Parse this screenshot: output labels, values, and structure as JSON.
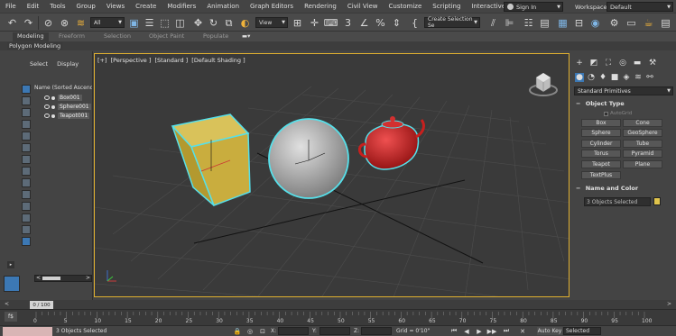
{
  "menus": [
    "File",
    "Edit",
    "Tools",
    "Group",
    "Views",
    "Create",
    "Modifiers",
    "Animation",
    "Graph Editors",
    "Rendering",
    "Civil View",
    "Customize",
    "Scripting",
    "Interactive"
  ],
  "signin_label": "Sign In",
  "workspaces_label": "Workspaces:",
  "workspace_value": "Default",
  "toolbar": {
    "filter_value": "All",
    "coord_system": "View",
    "selection_set_placeholder": "Create Selection Se"
  },
  "ribbon_tabs": [
    "Modeling",
    "Freeform",
    "Selection",
    "Object Paint",
    "Populate"
  ],
  "ribbon_active": "Modeling",
  "ribbon_sub_label": "Polygon Modeling",
  "scene_explorer": {
    "tabs": [
      "Select",
      "Display"
    ],
    "header": "Name (Sorted Ascending)",
    "items": [
      "Box001",
      "Sphere001",
      "Teapot001"
    ]
  },
  "viewport_label": [
    "[+]",
    "[Perspective ]",
    "[Standard ]",
    "[Default Shading ]"
  ],
  "command_panel": {
    "category": "Standard Primitives",
    "object_type_title": "Object Type",
    "autogrid_label": "AutoGrid",
    "object_buttons": [
      "Box",
      "Cone",
      "Sphere",
      "GeoSphere",
      "Cylinder",
      "Tube",
      "Torus",
      "Pyramid",
      "Teapot",
      "Plane",
      "TextPlus"
    ],
    "name_color_title": "Name and Color",
    "name_value": "3 Objects Selected",
    "swatch_color": "#e0c44c"
  },
  "time_slider": {
    "value": "0 / 100",
    "left_arrow": "<",
    "right_arrow": ">"
  },
  "trackbar_ticks": [
    "0",
    "5",
    "10",
    "15",
    "20",
    "25",
    "30",
    "35",
    "40",
    "45",
    "50",
    "55",
    "60",
    "65",
    "70",
    "75",
    "80",
    "85",
    "90",
    "95",
    "100"
  ],
  "status": {
    "text": "3 Objects Selected",
    "x_label": "X:",
    "y_label": "Y:",
    "z_label": "Z:",
    "grid": "Grid = 0'10\"",
    "autokey": "Auto Key",
    "selected": "Selected"
  },
  "colors": {
    "viewport_border": "#e0b030",
    "box": "#c9ad3e",
    "sphere": "#b8b8b8",
    "teapot": "#c8201e",
    "selection_outline": "#56e0ea",
    "active_blue": "#3c78b4"
  }
}
